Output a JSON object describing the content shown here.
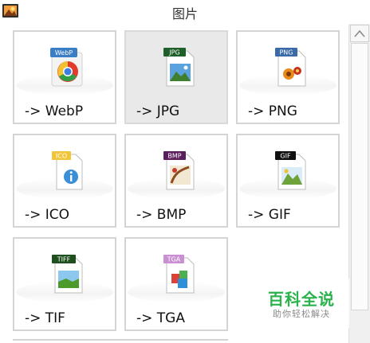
{
  "window": {
    "title": "图片"
  },
  "tiles": [
    {
      "label": "-> WebP",
      "badge": "WebP",
      "icon": "chrome-webp-icon",
      "selected": false
    },
    {
      "label": "-> JPG",
      "badge": "JPG",
      "icon": "jpg-file-icon",
      "selected": true
    },
    {
      "label": "-> PNG",
      "badge": "PNG",
      "icon": "png-file-icon",
      "selected": false
    },
    {
      "label": "-> ICO",
      "badge": "ICO",
      "icon": "ico-file-icon",
      "selected": false
    },
    {
      "label": "-> BMP",
      "badge": "BMP",
      "icon": "bmp-file-icon",
      "selected": false
    },
    {
      "label": "-> GIF",
      "badge": "GIF",
      "icon": "gif-file-icon",
      "selected": false
    },
    {
      "label": "-> TIF",
      "badge": "TIFF",
      "icon": "tiff-file-icon",
      "selected": false
    },
    {
      "label": "-> TGA",
      "badge": "TGA",
      "icon": "tga-file-icon",
      "selected": false
    }
  ],
  "watermark": {
    "main": "百科全说",
    "sub": "助你轻松解决"
  },
  "colors": {
    "tile_border": "#d4d4d4",
    "selected_bg": "#e9e9e9",
    "watermark_green": "#2bb24c"
  }
}
